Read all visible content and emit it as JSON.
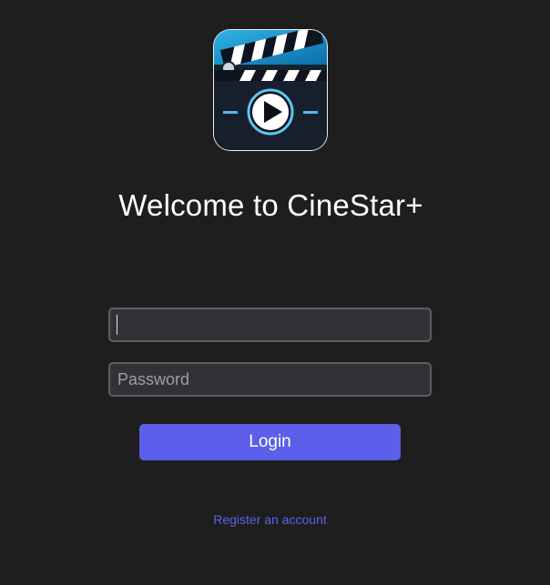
{
  "app": {
    "logo_icon": "clapperboard-play-icon",
    "title": "Welcome to CineStar+"
  },
  "form": {
    "username_value": "",
    "password_placeholder": "Password",
    "login_label": "Login",
    "register_label": "Register an account"
  },
  "colors": {
    "background": "#1e1e1f",
    "accent": "#5b5fe9",
    "link": "#5d62e6",
    "input_background": "#313235",
    "input_border": "#5b5e63"
  }
}
